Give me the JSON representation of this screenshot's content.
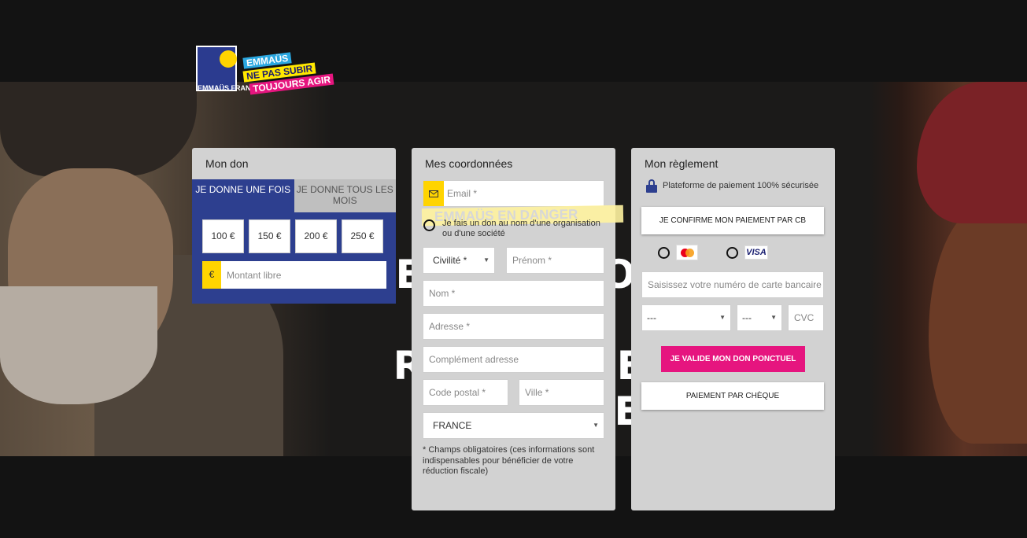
{
  "brand": {
    "logo_lines": [
      "EMMAÜS",
      "NE PAS SUBIR",
      "TOUJOURS AGIR"
    ],
    "logo_name": "EMMAÜS FRANCE"
  },
  "hero": {
    "watermark_lines": [
      "LES LAISSONS",
      "PAS RETOURNER",
      "À LA RUE"
    ]
  },
  "donation": {
    "title": "Mon don",
    "tabs": [
      "JE DONNE UNE FOIS",
      "JE DONNE TOUS LES MOIS"
    ],
    "active_tab": "JE DONNE UNE FOIS",
    "amounts": [
      "100 €",
      "150 €",
      "200 €",
      "250 €"
    ],
    "currency_symbol": "€",
    "free_amount_placeholder": "Montant libre"
  },
  "contact": {
    "title": "Mes coordonnées",
    "email_placeholder": "Email *",
    "banner_text": "EMMAÜS EN DANGER",
    "organisation_label": "Je fais un don au nom d'une organisation ou d'une société",
    "civility": "Civilité *",
    "firstname_placeholder": "Prénom *",
    "lastname_placeholder": "Nom *",
    "address_placeholder": "Adresse *",
    "address2_placeholder": "Complément adresse",
    "zip_placeholder": "Code postal *",
    "city_placeholder": "Ville *",
    "country": "FRANCE",
    "required_note": "* Champs obligatoires (ces informations sont indispensables pour bénéficier de votre réduction fiscale)"
  },
  "payment": {
    "title": "Mon règlement",
    "secure_text": "Plateforme de paiement 100% sécurisée",
    "confirm_cb_label": "JE CONFIRME MON PAIEMENT PAR CB",
    "card_brands": [
      "mastercard-icon",
      "visa-icon"
    ],
    "visa_text": "VISA",
    "card_number_placeholder": "Saisissez votre numéro de carte bancaire",
    "month_value": "---",
    "year_value": "---",
    "cvc_placeholder": "CVC",
    "validate_label": "JE VALIDE MON DON PONCTUEL",
    "cheque_label": "PAIEMENT PAR CHÈQUE"
  },
  "colors": {
    "background": "#131313",
    "panel": "#d2d2d2",
    "brand_blue": "#2d3f8f",
    "accent_yellow": "#ffd400",
    "accent_pink": "#e6157f"
  }
}
